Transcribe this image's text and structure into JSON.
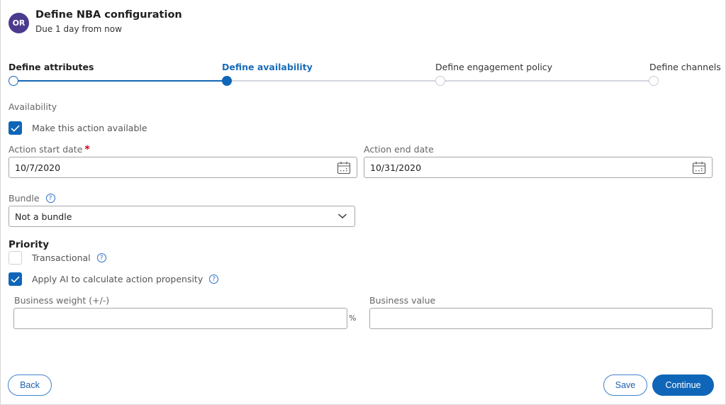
{
  "header": {
    "avatar_initials": "OR",
    "title": "Define NBA configuration",
    "subtitle": "Due 1 day from now"
  },
  "steps": [
    {
      "label": "Define attributes",
      "state": "completed"
    },
    {
      "label": "Define availability",
      "state": "current"
    },
    {
      "label": "Define engagement policy",
      "state": "upcoming"
    },
    {
      "label": "Define channels",
      "state": "upcoming"
    }
  ],
  "availability": {
    "section_label": "Availability",
    "make_available": {
      "label": "Make this action available",
      "checked": true
    },
    "start_date": {
      "label": "Action start date",
      "required_marker": "*",
      "value": "10/7/2020"
    },
    "end_date": {
      "label": "Action end date",
      "value": "10/31/2020"
    },
    "bundle": {
      "label": "Bundle",
      "help": "?",
      "selected": "Not a bundle"
    }
  },
  "priority": {
    "heading": "Priority",
    "transactional": {
      "label": "Transactional",
      "checked": false,
      "help": "?"
    },
    "apply_ai": {
      "label": "Apply AI to calculate action propensity",
      "checked": true,
      "help": "?"
    },
    "business_weight": {
      "label": "Business weight (+/-)",
      "value": "",
      "unit": "%"
    },
    "business_value": {
      "label": "Business value",
      "value": ""
    }
  },
  "footer": {
    "back_label": "Back",
    "save_label": "Save",
    "continue_label": "Continue"
  },
  "colors": {
    "accent": "#0f66b8",
    "avatar": "#4c3a8e",
    "required": "#d0021b"
  }
}
